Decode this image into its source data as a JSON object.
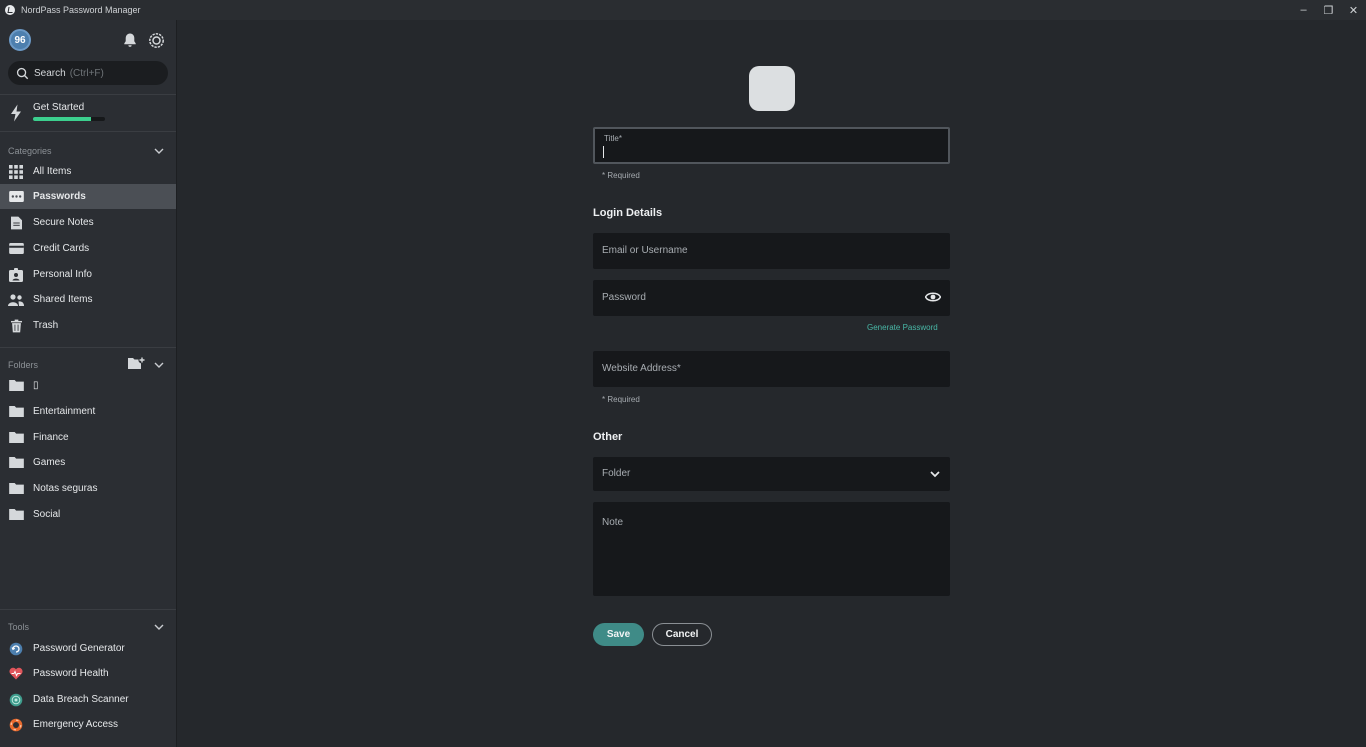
{
  "window": {
    "title": "NordPass Password Manager",
    "minimize": "–",
    "maximize": "❐",
    "close": "✕"
  },
  "sidebar": {
    "avatar": "96",
    "search": {
      "label": "Search",
      "hint": "(Ctrl+F)"
    },
    "get_started": {
      "label": "Get Started",
      "progress": 0.8
    },
    "categories_label": "Categories",
    "categories": [
      {
        "label": "All Items",
        "icon": "grid-icon"
      },
      {
        "label": "Passwords",
        "icon": "password-icon"
      },
      {
        "label": "Secure Notes",
        "icon": "note-icon"
      },
      {
        "label": "Credit Cards",
        "icon": "card-icon"
      },
      {
        "label": "Personal Info",
        "icon": "id-icon"
      },
      {
        "label": "Shared Items",
        "icon": "people-icon"
      },
      {
        "label": "Trash",
        "icon": "trash-icon"
      }
    ],
    "folders_label": "Folders",
    "folders": [
      "▯",
      "Entertainment",
      "Finance",
      "Games",
      "Notas seguras",
      "Social"
    ],
    "tools_label": "Tools",
    "tools": [
      {
        "label": "Password Generator",
        "icon": "generator-icon"
      },
      {
        "label": "Password Health",
        "icon": "health-icon"
      },
      {
        "label": "Data Breach Scanner",
        "icon": "scanner-icon"
      },
      {
        "label": "Emergency Access",
        "icon": "lifebuoy-icon"
      }
    ]
  },
  "form": {
    "title_label": "Title*",
    "required_note": "* Required",
    "login_heading": "Login Details",
    "email_placeholder": "Email or Username",
    "password_placeholder": "Password",
    "generate_label": "Generate Password",
    "website_placeholder": "Website Address*",
    "website_required": "* Required",
    "other_heading": "Other",
    "folder_placeholder": "Folder",
    "note_placeholder": "Note",
    "save_label": "Save",
    "cancel_label": "Cancel"
  }
}
